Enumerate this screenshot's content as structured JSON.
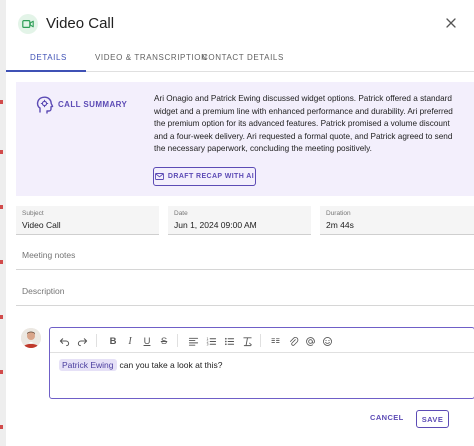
{
  "header": {
    "title": "Video Call",
    "icon": "video-camera-icon",
    "close_icon": "close-icon"
  },
  "tabs": [
    {
      "label": "DETAILS",
      "active": true
    },
    {
      "label": "VIDEO & TRANSCRIPTION",
      "active": false
    },
    {
      "label": "CONTACT DETAILS",
      "active": false
    }
  ],
  "summary": {
    "label": "CALL SUMMARY",
    "icon": "ai-head-icon",
    "text": "Ari Onagio and Patrick Ewing discussed widget options. Patrick offered a standard widget and a premium line with enhanced performance and durability. Ari preferred the premium option for its advanced features. Patrick promised a volume discount and a four-week delivery. Ari requested a formal quote, and Patrick agreed to send the necessary paperwork, concluding the meeting positively.",
    "recap_button": "DRAFT RECAP WITH AI",
    "recap_icon": "mail-icon"
  },
  "fields": {
    "subject": {
      "label": "Subject",
      "value": "Video Call"
    },
    "date": {
      "label": "Date",
      "value": "Jun 1, 2024 09:00 AM"
    },
    "duration": {
      "label": "Duration",
      "value": "2m 44s"
    }
  },
  "meeting_notes": {
    "placeholder": "Meeting notes"
  },
  "description": {
    "placeholder": "Description"
  },
  "editor": {
    "toolbar_icons": [
      "undo-icon",
      "redo-icon",
      "bold-icon",
      "italic-icon",
      "underline-icon",
      "strikethrough-icon",
      "align-left-icon",
      "numbered-list-icon",
      "bullet-list-icon",
      "clear-format-icon",
      "quote-icon",
      "attachment-icon",
      "mention-icon",
      "emoji-icon"
    ],
    "mention": "Patrick Ewing",
    "text": "can you take a look at this?"
  },
  "actions": {
    "cancel": "CANCEL",
    "save": "SAVE"
  },
  "colors": {
    "accent": "#5c4bb5",
    "tab_active": "#3f51b5",
    "summary_bg": "#f3effc",
    "call_icon_bg": "#e3f4e8",
    "call_icon": "#2e9e57"
  }
}
